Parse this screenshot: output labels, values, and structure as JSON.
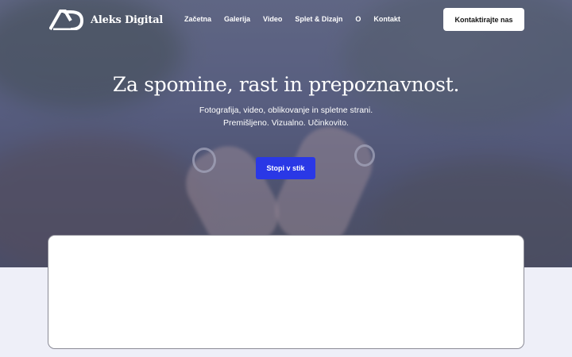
{
  "brand": {
    "name": "Aleks Digital",
    "logo_icon": "ad-monogram-icon"
  },
  "nav": {
    "items": [
      {
        "label": "Začetna"
      },
      {
        "label": "Galerija"
      },
      {
        "label": "Video"
      },
      {
        "label": "Splet & Dizajn"
      },
      {
        "label": "O"
      },
      {
        "label": "Kontakt"
      }
    ],
    "contact_button": "Kontaktirajte nas"
  },
  "hero": {
    "title": "Za spomine, rast in prepoznavnost.",
    "subtitle_line1": "Fotografija, video, oblikovanje in spletne strani.",
    "subtitle_line2": "Premišljeno. Vizualno. Učinkovito.",
    "cta_label": "Stopi v stik"
  },
  "colors": {
    "accent": "#2a38e6",
    "hero_tint": "#373c69",
    "page_background": "#eeeff8",
    "card_background": "#ffffff"
  }
}
